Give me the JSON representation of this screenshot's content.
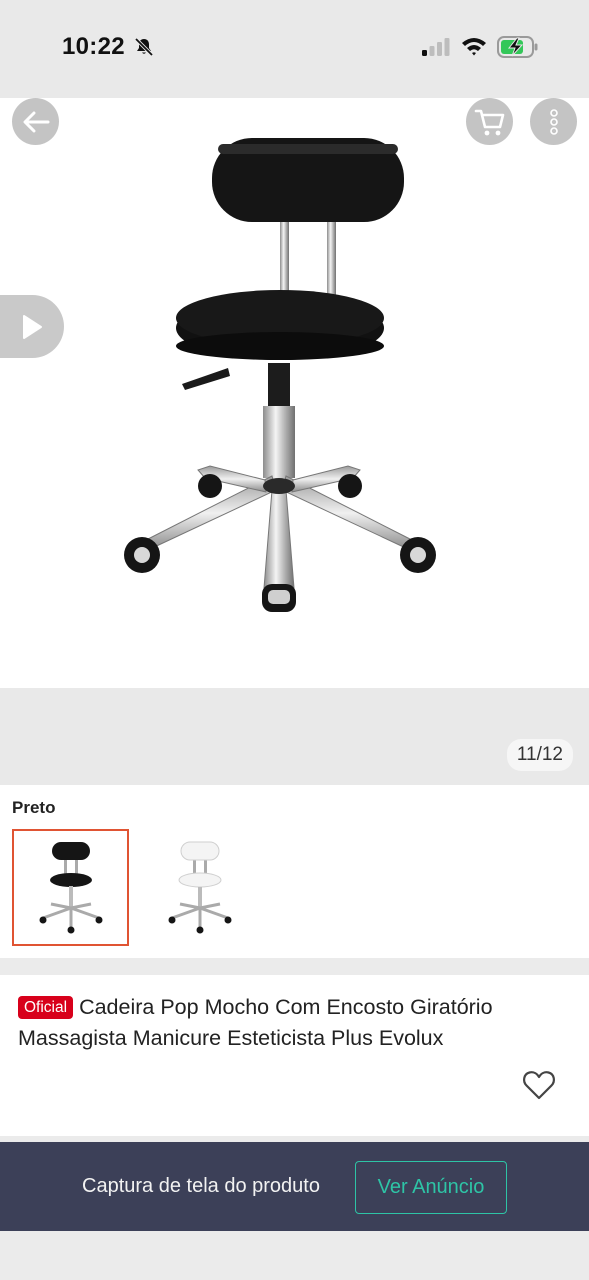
{
  "status_bar": {
    "time": "10:22",
    "icons": [
      "bell-slash-icon",
      "signal-icon",
      "wifi-icon",
      "battery-charging-icon"
    ]
  },
  "gallery": {
    "counter": "11/12",
    "buttons": [
      "back-arrow-icon",
      "cart-icon",
      "more-vertical-icon",
      "play-icon"
    ]
  },
  "variants": {
    "label": "Preto",
    "options": [
      "black-stool",
      "white-stool"
    ],
    "selected_index": 0
  },
  "product": {
    "badge": "Oficial",
    "title": "Cadeira Pop Mocho Com Encosto Giratório Massagista Manicure Esteticista Plus Evolux"
  },
  "capture_bar": {
    "text": "Captura de tela do produto",
    "button_label": "Ver Anúncio"
  },
  "colors": {
    "accent": "#2ec4a6",
    "badge": "#d8001b",
    "selected_border": "#e05433",
    "bar_bg": "#3c4058"
  }
}
